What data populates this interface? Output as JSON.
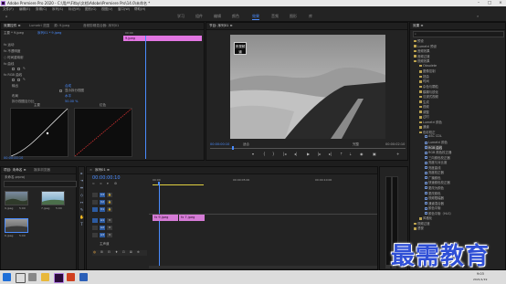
{
  "window": {
    "title": "Adobe Premiere Pro 2020 - C:\\用户\\Fitby\\文档\\Adobe\\Premiere Pro\\14.0\\未命名 *"
  },
  "menu": [
    "文件(F)",
    "编辑(E)",
    "剪辑(C)",
    "序列(S)",
    "标记(M)",
    "图形(G)",
    "视图(V)",
    "窗口(W)",
    "帮助(H)"
  ],
  "workspaces": [
    "学习",
    "组件",
    "编辑",
    "颜色",
    "效果",
    "音频",
    "图形",
    "库"
  ],
  "workspace_active": "效果",
  "effect_controls": {
    "tabs": [
      "效果控件 ≡",
      "Lumetri 范围",
      "源: 9.jpeg",
      "音频剪辑混合器: 序列01"
    ],
    "master": "主要 * 9.jpeg",
    "clip": "序列01 * 9.jpeg",
    "ruler": "00:00",
    "clip_label": "9.jpeg",
    "rows": [
      "fx 运动",
      "fx 不透明度",
      "○ 时间重映射",
      "fx 曲线",
      "fx RGB 曲线",
      "输出",
      "显示拆分视图",
      "布局",
      "拆分视图百分比"
    ],
    "values": {
      "output": "合成",
      "split_layout": "水平",
      "split_percent": "50.00 %"
    },
    "curve_labels": {
      "left": "主要",
      "right": "红色"
    },
    "timecode": "00:00:00:10"
  },
  "program": {
    "tab": "节目: 序列01 ≡",
    "timecode_left": "00:00:00:10",
    "fit": "适合",
    "quality": "完整",
    "timecode_right": "00:00:02:10",
    "watermark": "央视频道"
  },
  "project": {
    "tabs": [
      "项目: 未命名 ≡",
      "媒体浏览器"
    ],
    "file": "未命名.prproj",
    "items": [
      {
        "name": "9.jpeg",
        "dur": "5:00"
      },
      {
        "name": "7.jpeg",
        "dur": "5:00"
      },
      {
        "name": "6.jpeg",
        "dur": "5:00"
      }
    ]
  },
  "timeline": {
    "tab": "序列01 ≡",
    "timecode": "00:00:00:10",
    "ruler": [
      "00:00",
      "00:00:05:00",
      "00:00:10:00"
    ],
    "tracks": [
      "V3",
      "V2",
      "V1",
      "A1",
      "A2",
      "A3"
    ],
    "clips": [
      "fx 9.jpeg",
      "fx 7.jpeg"
    ],
    "master": "主声道"
  },
  "effects": {
    "tab": "效果 ≡",
    "search": "",
    "items": [
      "预设",
      "Lumetri 预设",
      "音频效果",
      "音频过渡",
      "视频效果",
      "Obsolete",
      "图像控制",
      "扭曲",
      "时间",
      "杂色与颗粒",
      "模糊与锐化",
      "沉浸式视频",
      "生成",
      "视频",
      "调整",
      "过时",
      "Lumetri 颜色",
      "通道",
      "色彩校正",
      "ASC CDL",
      "Lumetri 颜色",
      "RGB 曲线",
      "RGB 颜色校正器",
      "三向颜色校正器",
      "亮度与对比度",
      "亮度曲线",
      "亮度校正器",
      "广播颜色",
      "快速颜色校正器",
      "更改为颜色",
      "更改颜色",
      "视频限幅器",
      "通道混合器",
      "颜色平衡",
      "颜色平衡（HLS）",
      "风格化",
      "视频过渡",
      "透视"
    ],
    "selected": "RGB 曲线"
  },
  "taskbar": {
    "time": "9:03",
    "date": "2021/1/19"
  },
  "overlay": {
    "text": "最需教育"
  },
  "colors": {
    "accent": "#4a8cff",
    "clip": "#e276e2",
    "watermark": "#2f4fd6"
  }
}
